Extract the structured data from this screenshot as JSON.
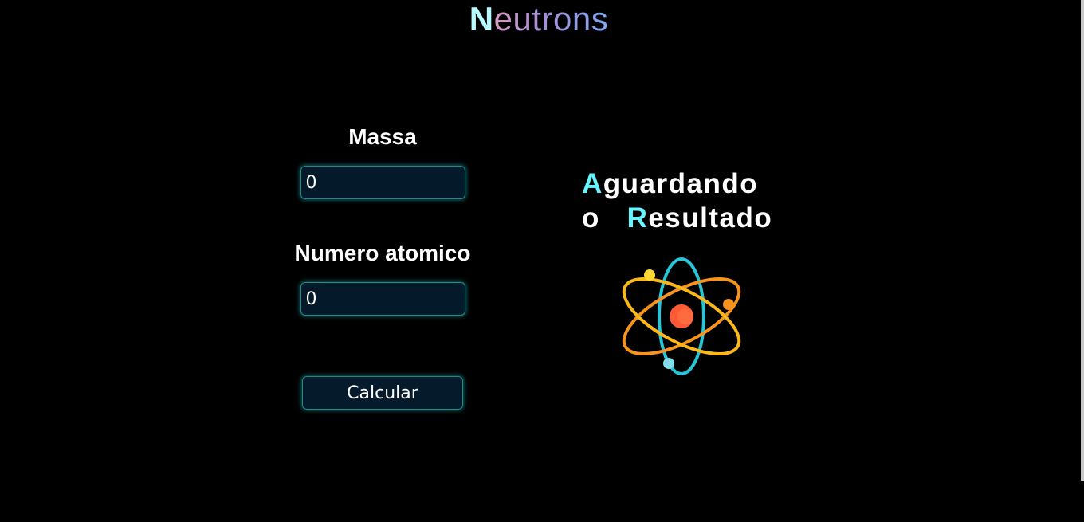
{
  "header": {
    "title_first": "N",
    "title_rest": "eutrons"
  },
  "form": {
    "massa_label": "Massa",
    "massa_value": "0",
    "numero_label": "Numero atomico",
    "numero_value": "0",
    "calc_button": "Calcular"
  },
  "result": {
    "line1_first": "A",
    "line1_rest": "guardando",
    "line2_first": "o   ",
    "line2_hl": "R",
    "line2_rest": "esultado"
  },
  "icons": {
    "atom": "atom-icon"
  },
  "colors": {
    "background": "#000000",
    "accent": "#66f4ff",
    "input_bg": "#04192a",
    "input_border": "#1b8a8c",
    "nucleus": "#ff5a36",
    "orbit_cyan": "#26c6da",
    "orbit_orange": "#f7941d",
    "orbit_yellow": "#fbb819"
  }
}
